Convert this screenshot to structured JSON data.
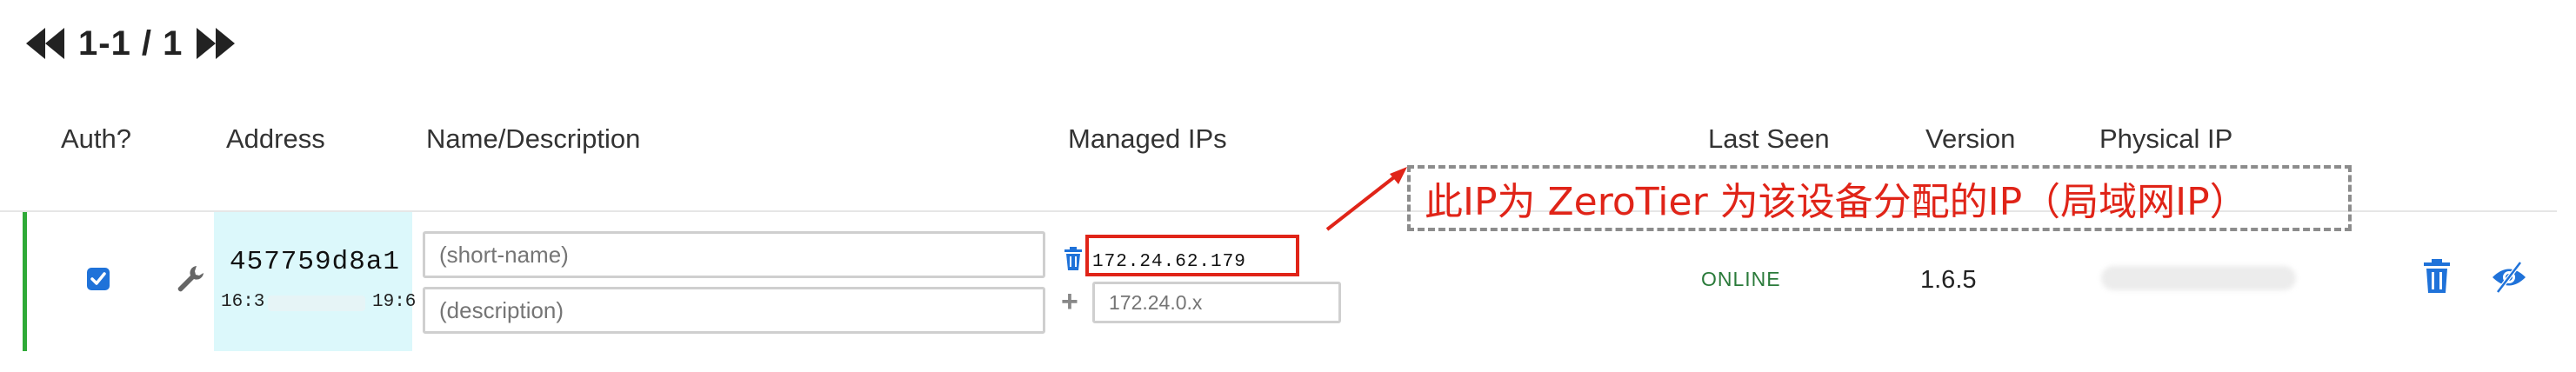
{
  "pager": {
    "range": "1-1 / 1"
  },
  "table": {
    "headers": {
      "auth": "Auth?",
      "address": "Address",
      "name": "Name/Description",
      "managed_ips": "Managed IPs",
      "last_seen": "Last Seen",
      "version": "Version",
      "physical_ip": "Physical IP"
    },
    "row": {
      "authorized": true,
      "address": "457759d8a1",
      "mac_prefix": "16:3",
      "mac_suffix": "19:6",
      "name_placeholder": "(short-name)",
      "description_placeholder": "(description)",
      "managed_ip": "172.24.62.179",
      "new_ip_placeholder": "172.24.0.x",
      "last_seen": "ONLINE",
      "version": "1.6.5"
    }
  },
  "annotation": {
    "text": "此IP为 ZeroTier 为该设备分配的IP（局域网IP）"
  },
  "colors": {
    "accent_blue": "#1f72d9",
    "online_green": "#2a7a3a",
    "row_bar_green": "#2eaa37",
    "address_bg": "#dcf8fb",
    "annotation_red": "#e02418"
  },
  "icons": {
    "first": "double-left-arrow-icon",
    "last": "double-right-arrow-icon",
    "wrench": "wrench-icon",
    "delete_ip": "trash-icon",
    "add_ip": "plus-icon",
    "delete_member": "trash-icon",
    "hide": "eye-slash-icon"
  }
}
